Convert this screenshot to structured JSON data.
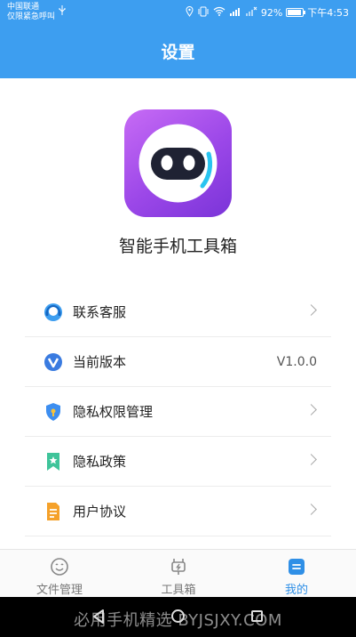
{
  "status_bar": {
    "carrier_line1": "中国联通",
    "carrier_line2": "仅限紧急呼叫",
    "battery_text": "92%",
    "time": "下午4:53"
  },
  "header": {
    "title": "设置"
  },
  "app": {
    "name": "智能手机工具箱"
  },
  "menu": {
    "items": [
      {
        "label": "联系客服",
        "icon": "customer-service-icon",
        "has_chevron": true
      },
      {
        "label": "当前版本",
        "icon": "version-icon",
        "value": "V1.0.0"
      },
      {
        "label": "隐私权限管理",
        "icon": "privacy-permission-icon",
        "has_chevron": true
      },
      {
        "label": "隐私政策",
        "icon": "privacy-policy-icon",
        "has_chevron": true
      },
      {
        "label": "用户协议",
        "icon": "user-agreement-icon",
        "has_chevron": true
      }
    ]
  },
  "tabbar": {
    "tabs": [
      {
        "label": "文件管理",
        "icon": "file-manager-icon",
        "active": false
      },
      {
        "label": "工具箱",
        "icon": "toolbox-icon",
        "active": false
      },
      {
        "label": "我的",
        "icon": "profile-icon",
        "active": true
      }
    ]
  },
  "watermark": {
    "text": "必用手机精选 BYJSJXY.COM"
  },
  "colors": {
    "primary": "#3d9ef0",
    "active_tab": "#2f8fe6",
    "logo_purple": "#9b47e8"
  }
}
